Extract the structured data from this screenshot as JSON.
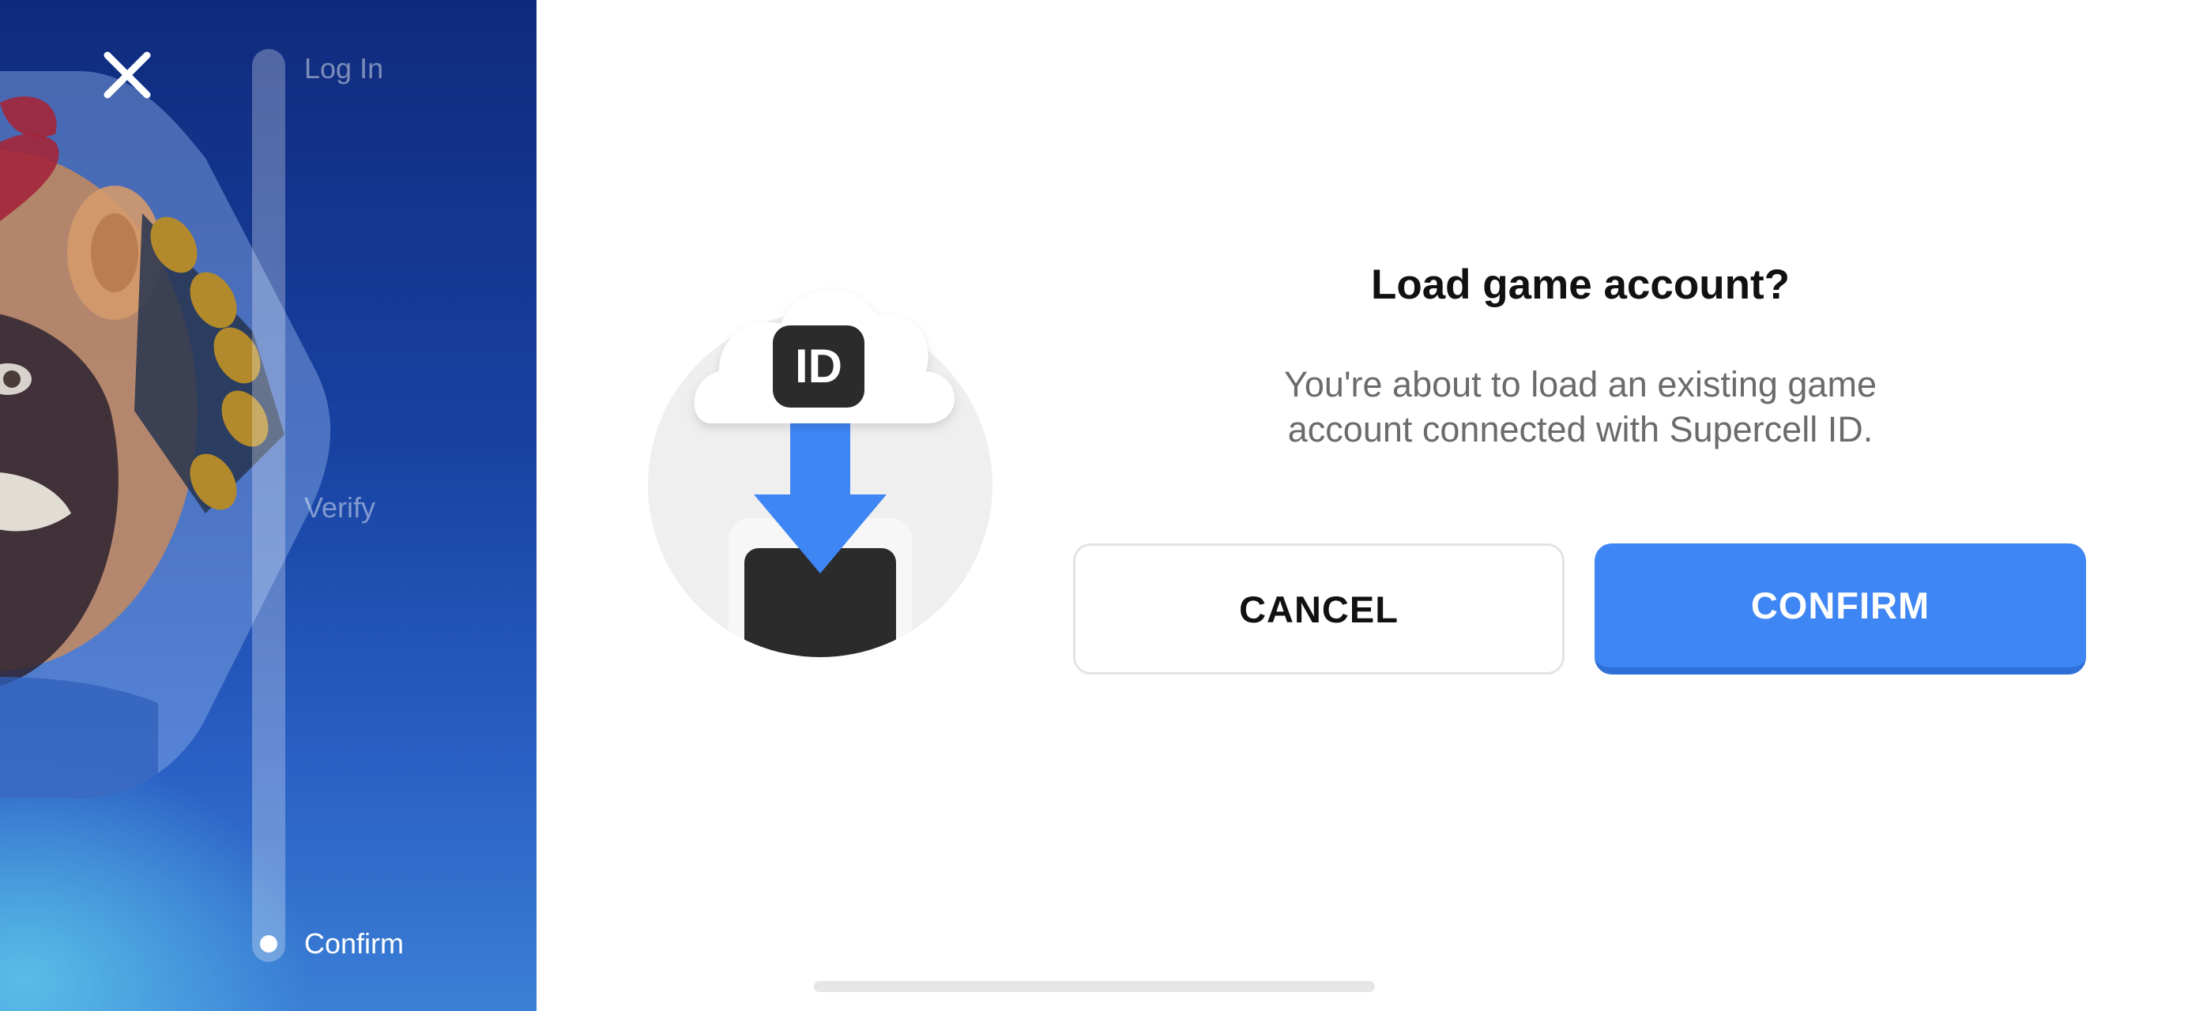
{
  "progress": {
    "steps": [
      "Log In",
      "Verify",
      "Confirm"
    ],
    "current_step": "Confirm"
  },
  "illustration": {
    "badge_text": "ID",
    "accent_color": "#3f86f5"
  },
  "dialog": {
    "title": "Load game account?",
    "message": "You're about to load an existing game account connected with Supercell ID.",
    "cancel_label": "CANCEL",
    "confirm_label": "CONFIRM"
  },
  "colors": {
    "confirm_button": "#3f86f5",
    "panel_blue": "#1843a3",
    "title_text": "#111111",
    "message_text": "#6b6b6b"
  },
  "icons": {
    "close": "close-icon",
    "cloud": "cloud-icon",
    "download_arrow": "download-arrow-icon",
    "device": "device-icon"
  }
}
